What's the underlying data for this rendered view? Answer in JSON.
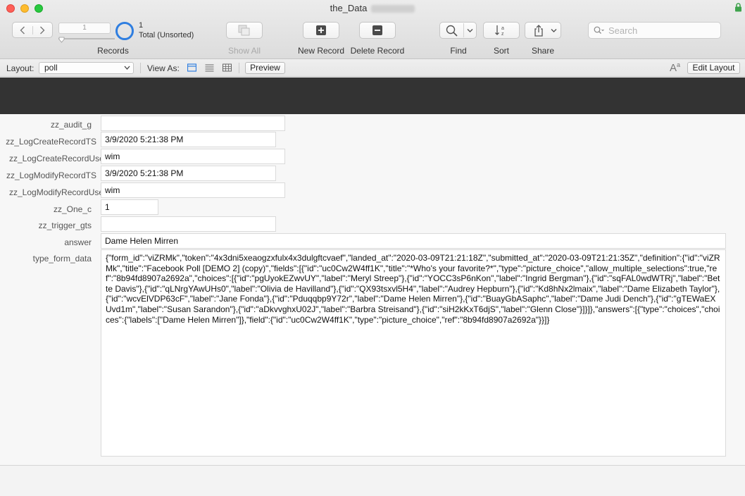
{
  "window": {
    "title": "the_Data"
  },
  "toolbar": {
    "record_number": "1",
    "found_count": "1",
    "total_label": "Total (Unsorted)",
    "records_label": "Records",
    "show_all_label": "Show All",
    "new_record_label": "New Record",
    "delete_record_label": "Delete Record",
    "find_label": "Find",
    "sort_label": "Sort",
    "share_label": "Share",
    "search_placeholder": "Search"
  },
  "layout_bar": {
    "layout_label": "Layout:",
    "layout_value": "poll",
    "view_as_label": "View As:",
    "preview_label": "Preview",
    "edit_layout_label": "Edit Layout",
    "font_icon_text": "A",
    "font_icon_sup": "a"
  },
  "form": {
    "fields": [
      {
        "label": "zz_audit_g",
        "value": ""
      },
      {
        "label": "zz_LogCreateRecordTS",
        "value": "3/9/2020 5:21:38 PM"
      },
      {
        "label": "zz_LogCreateRecordUse",
        "value": "wim"
      },
      {
        "label": "zz_LogModifyRecordTS",
        "value": "3/9/2020 5:21:38 PM"
      },
      {
        "label": "zz_LogModifyRecordUse",
        "value": "wim"
      },
      {
        "label": "zz_One_c",
        "value": "1"
      },
      {
        "label": "zz_trigger_gts",
        "value": ""
      },
      {
        "label": "answer",
        "value": "Dame Helen Mirren"
      },
      {
        "label": "type_form_data",
        "value": "{\"form_id\":\"viZRMk\",\"token\":\"4x3dni5xeaogzxfulx4x3dulgftcvaef\",\"landed_at\":\"2020-03-09T21:21:18Z\",\"submitted_at\":\"2020-03-09T21:21:35Z\",\"definition\":{\"id\":\"viZRMk\",\"title\":\"Facebook Poll [DEMO 2] (copy)\",\"fields\":[{\"id\":\"uc0Cw2W4ff1K\",\"title\":\"*Who's your favorite?*\",\"type\":\"picture_choice\",\"allow_multiple_selections\":true,\"ref\":\"8b94fd8907a2692a\",\"choices\":[{\"id\":\"pgUyokEZwvUY\",\"label\":\"Meryl Streep\"},{\"id\":\"YOCC3sP6nKon\",\"label\":\"Ingrid Bergman\"},{\"id\":\"sqFAL0wdWTRj\",\"label\":\"Bette Davis\"},{\"id\":\"qLNrgYAwUHs0\",\"label\":\"Olivia de Havilland\"},{\"id\":\"QX93tsxvl5H4\",\"label\":\"Audrey Hepburn\"},{\"id\":\"Kd8hNx2lmaix\",\"label\":\"Dame Elizabeth Taylor\"},{\"id\":\"wcvElVDP63cF\",\"label\":\"Jane Fonda\"},{\"id\":\"Pduqqbp9Y72r\",\"label\":\"Dame Helen Mirren\"},{\"id\":\"BuayGbASaphc\",\"label\":\"Dame Judi Dench\"},{\"id\":\"gTEWaEXUvd1m\",\"label\":\"Susan Sarandon\"},{\"id\":\"aDkvvghxU02J\",\"label\":\"Barbra Streisand\"},{\"id\":\"siH2kKxT6djS\",\"label\":\"Glenn Close\"}]}]},\"answers\":[{\"type\":\"choices\",\"choices\":{\"labels\":[\"Dame Helen Mirren\"]},\"field\":{\"id\":\"uc0Cw2W4ff1K\",\"type\":\"picture_choice\",\"ref\":\"8b94fd8907a2692a\"}}]}"
      }
    ]
  }
}
